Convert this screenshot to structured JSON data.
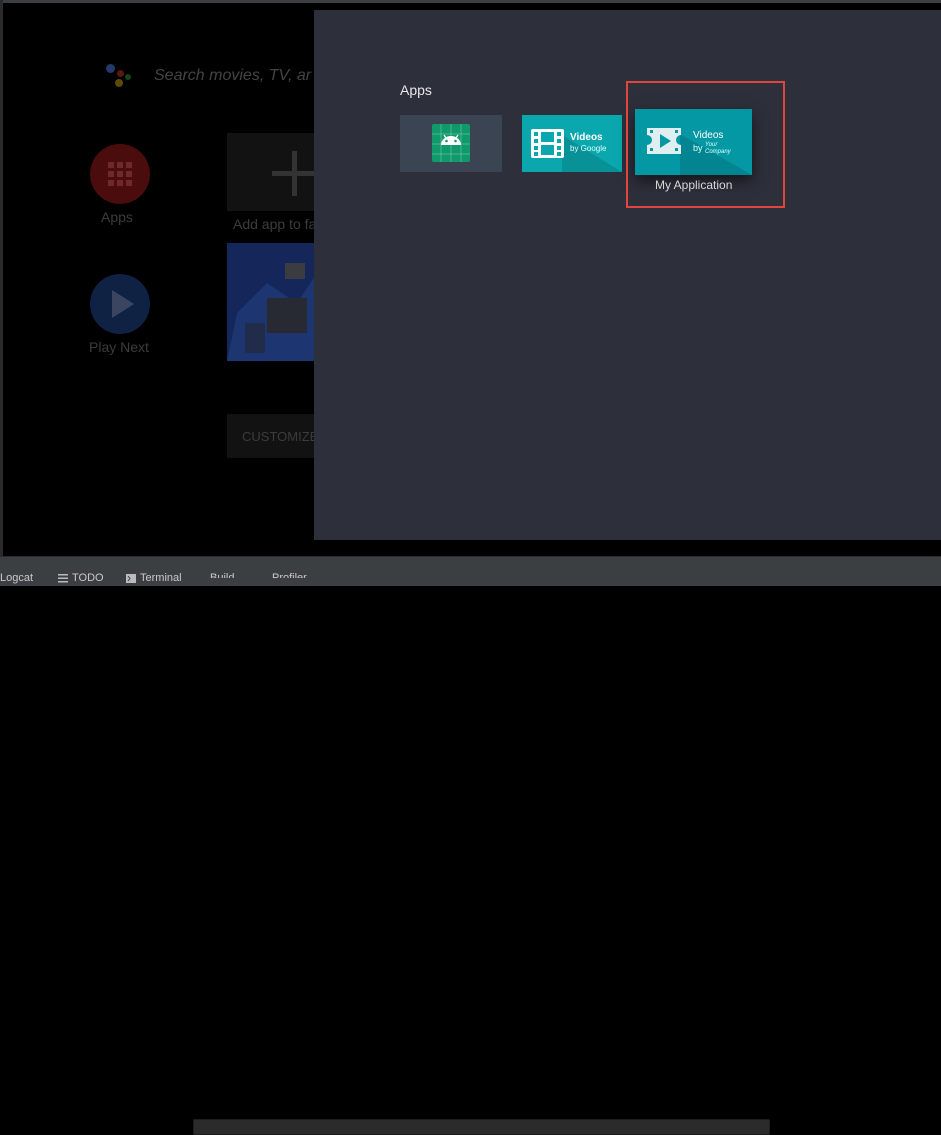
{
  "launcher": {
    "search_hint": "Search movies, TV, ar",
    "apps_label": "Apps",
    "play_next_label": "Play Next",
    "add_app_label": "Add app to fa",
    "customize_label": "CUSTOMIZE"
  },
  "apps_panel": {
    "title": "Apps",
    "tiles": [
      {
        "name": "android-app",
        "icon": "android-icon"
      },
      {
        "name": "videos-by-google",
        "title": "Videos",
        "subtitle": "by Google",
        "icon": "film-strip-icon"
      },
      {
        "name": "my-application",
        "title": "Videos",
        "by": "by",
        "company_line1": "Your",
        "company_line2": "Company",
        "icon": "video-ticket-icon",
        "label": "My Application"
      }
    ]
  },
  "bottom_bar": {
    "logcat": "Logcat",
    "todo": "TODO",
    "terminal": "Terminal",
    "build": "Build",
    "profiler": "Profiler"
  },
  "colors": {
    "panel_bg": "#2d2f3b",
    "highlight": "#e0453e",
    "teal": "#0aa7ae"
  }
}
